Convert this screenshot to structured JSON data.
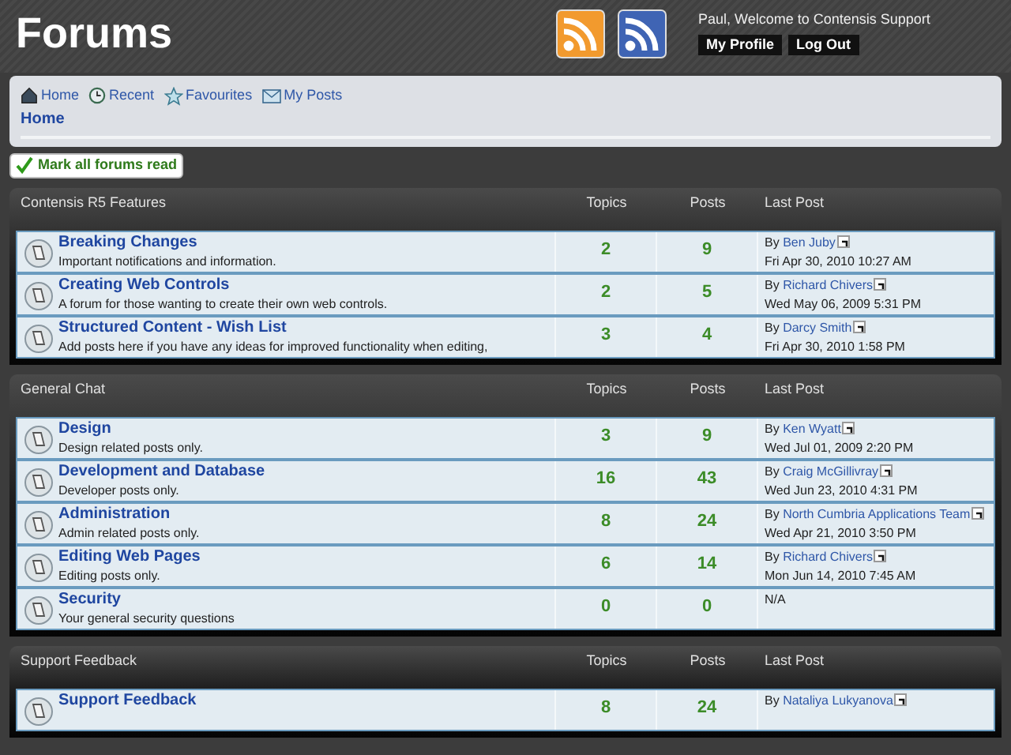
{
  "header": {
    "title": "Forums",
    "welcome": "Paul, Welcome to Contensis Support",
    "buttons": [
      "My Profile",
      "Log Out"
    ]
  },
  "nav": {
    "links": [
      {
        "label": "Home"
      },
      {
        "label": "Recent"
      },
      {
        "label": "Favourites"
      },
      {
        "label": "My Posts"
      }
    ],
    "breadcrumb": "Home"
  },
  "mark_read_button": "Mark all forums read",
  "sections": [
    {
      "title": "Contensis R5 Features",
      "columns": [
        "Topics",
        "Posts",
        "Last Post"
      ],
      "forums": [
        {
          "name": "Breaking Changes",
          "description": "Important notifications and information.",
          "topics": "2",
          "posts": "9",
          "last_post": {
            "kind": "post",
            "by": "By",
            "author": "Ben Juby",
            "date": "Fri Apr 30, 2010 10:27 AM"
          }
        },
        {
          "name": "Creating Web Controls",
          "description": "A forum for those wanting to create their own web controls.",
          "topics": "2",
          "posts": "5",
          "last_post": {
            "kind": "post",
            "by": "By",
            "author": "Richard Chivers",
            "date": "Wed May 06, 2009 5:31 PM"
          }
        },
        {
          "name": "Structured Content - Wish List",
          "description": "Add posts here if you have any ideas for improved functionality when editing,",
          "topics": "3",
          "posts": "4",
          "last_post": {
            "kind": "post",
            "by": "By",
            "author": "Darcy Smith",
            "date": "Fri Apr 30, 2010 1:58 PM"
          }
        }
      ]
    },
    {
      "title": "General Chat",
      "columns": [
        "Topics",
        "Posts",
        "Last Post"
      ],
      "forums": [
        {
          "name": "Design",
          "description": "Design related posts only.",
          "topics": "3",
          "posts": "9",
          "last_post": {
            "kind": "post",
            "by": "By",
            "author": "Ken Wyatt",
            "date": "Wed Jul 01, 2009 2:20 PM"
          }
        },
        {
          "name": "Development and Database",
          "description": "Developer posts only.",
          "topics": "16",
          "posts": "43",
          "last_post": {
            "kind": "post",
            "by": "By",
            "author": "Craig McGillivray",
            "date": "Wed Jun 23, 2010 4:31 PM"
          }
        },
        {
          "name": "Administration",
          "description": "Admin related posts only.",
          "topics": "8",
          "posts": "24",
          "last_post": {
            "kind": "post",
            "by": "By",
            "author": "North Cumbria Applications Team",
            "date": "Wed Apr 21, 2010 3:50 PM"
          }
        },
        {
          "name": "Editing Web Pages",
          "description": "Editing posts only.",
          "topics": "6",
          "posts": "14",
          "last_post": {
            "kind": "post",
            "by": "By",
            "author": "Richard Chivers",
            "date": "Mon Jun 14, 2010 7:45 AM"
          }
        },
        {
          "name": "Security",
          "description": "Your general security questions",
          "topics": "0",
          "posts": "0",
          "last_post": {
            "kind": "none",
            "text": "N/A"
          }
        }
      ]
    },
    {
      "title": "Support Feedback",
      "columns": [
        "Topics",
        "Posts",
        "Last Post"
      ],
      "forums": [
        {
          "name": "Support Feedback",
          "topics": "8",
          "posts": "24",
          "last_post": {
            "kind": "post",
            "by": "By",
            "author": "Nataliya Lukyanova"
          }
        }
      ]
    }
  ]
}
